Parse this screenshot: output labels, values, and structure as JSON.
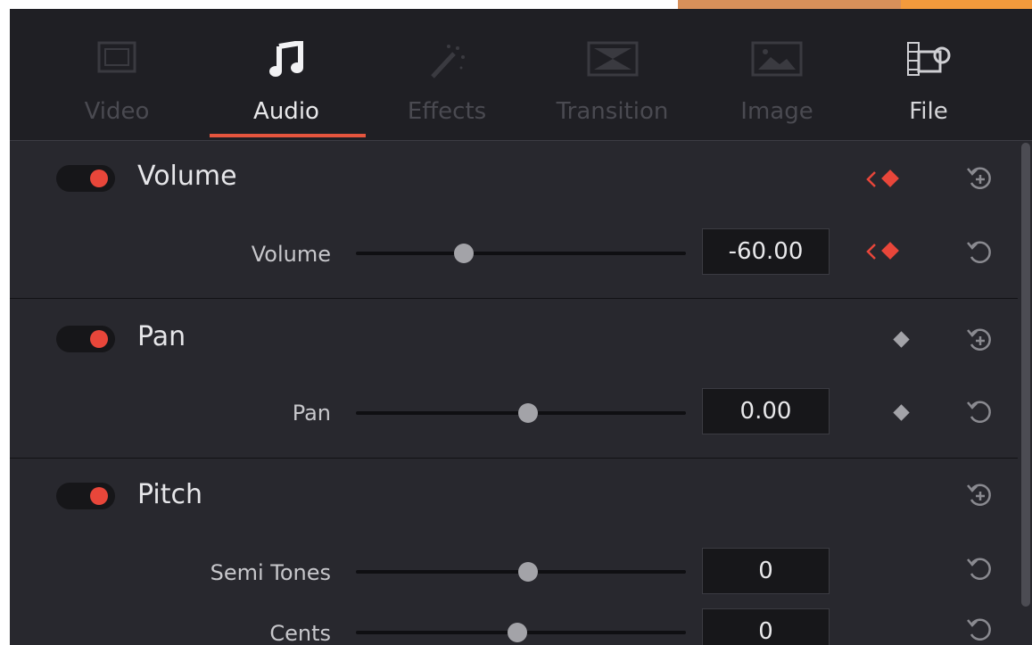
{
  "tabs": [
    {
      "label": "Video",
      "icon": "video-icon",
      "active": false
    },
    {
      "label": "Audio",
      "icon": "music-note-icon",
      "active": true
    },
    {
      "label": "Effects",
      "icon": "magic-wand-icon",
      "active": false
    },
    {
      "label": "Transition",
      "icon": "transition-icon",
      "active": false
    },
    {
      "label": "Image",
      "icon": "image-icon",
      "active": false
    },
    {
      "label": "File",
      "icon": "film-camera-icon",
      "active": false
    }
  ],
  "sections": {
    "volume": {
      "title": "Volume",
      "enabled": true,
      "params": [
        {
          "label": "Volume",
          "value": "-60.00",
          "slider": 0.3
        }
      ]
    },
    "pan": {
      "title": "Pan",
      "enabled": true,
      "params": [
        {
          "label": "Pan",
          "value": "0.00",
          "slider": 0.5
        }
      ]
    },
    "pitch": {
      "title": "Pitch",
      "enabled": true,
      "params": [
        {
          "label": "Semi Tones",
          "value": "0",
          "slider": 0.5
        },
        {
          "label": "Cents",
          "value": "0",
          "slider": 0.5
        }
      ]
    }
  },
  "colors": {
    "accent": "#e8463a",
    "underline": "#e5553e",
    "panel_bg": "#28282e",
    "tab_bg": "#1f1f24"
  }
}
